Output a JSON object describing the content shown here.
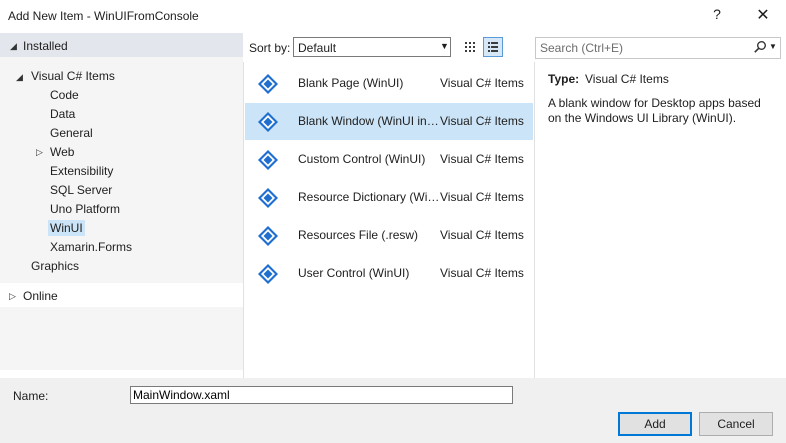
{
  "window": {
    "title": "Add New Item - WinUIFromConsole",
    "help_glyph": "?",
    "close_glyph": "✕"
  },
  "tree": {
    "installed": "Installed",
    "visual_csharp_items": "Visual C# Items",
    "children": [
      "Code",
      "Data",
      "General",
      "Web",
      "Extensibility",
      "SQL Server",
      "Uno Platform",
      "WinUI",
      "Xamarin.Forms"
    ],
    "graphics": "Graphics",
    "online": "Online",
    "selected": "WinUI"
  },
  "toolbar": {
    "sort_label": "Sort by:",
    "sort_value": "Default"
  },
  "items": [
    {
      "name": "Blank Page (WinUI)",
      "lang": "Visual C# Items",
      "selected": false
    },
    {
      "name": "Blank Window (WinUI in Desktop)",
      "lang": "Visual C# Items",
      "selected": true
    },
    {
      "name": "Custom Control (WinUI)",
      "lang": "Visual C# Items",
      "selected": false
    },
    {
      "name": "Resource Dictionary (WinUI)",
      "lang": "Visual C# Items",
      "selected": false
    },
    {
      "name": "Resources File (.resw)",
      "lang": "Visual C# Items",
      "selected": false
    },
    {
      "name": "User Control (WinUI)",
      "lang": "Visual C# Items",
      "selected": false
    }
  ],
  "search": {
    "placeholder": "Search (Ctrl+E)"
  },
  "details": {
    "type_label": "Type:",
    "type_value": "Visual C# Items",
    "description": "A blank window for Desktop apps based on the Windows UI Library (WinUI)."
  },
  "bottom": {
    "name_label": "Name:",
    "name_value": "MainWindow.xaml",
    "add_label": "Add",
    "cancel_label": "Cancel"
  },
  "colors": {
    "selection": "#cce4f7",
    "accent": "#0078d7",
    "icon_blue": "#1f6fd1"
  }
}
